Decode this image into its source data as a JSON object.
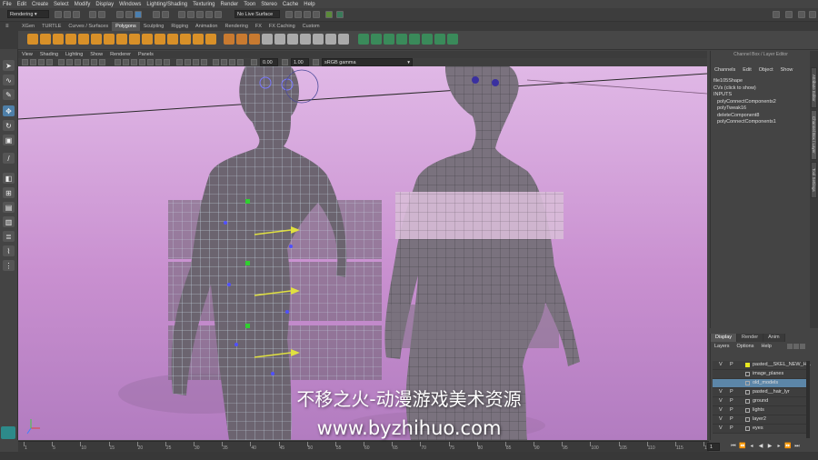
{
  "menubar": [
    "File",
    "Edit",
    "Create",
    "Select",
    "Modify",
    "Display",
    "Windows",
    "Lighting/Shading",
    "Texturing",
    "Render",
    "Toon",
    "Stereo",
    "Cache",
    "Help"
  ],
  "status": {
    "menuset": "Rendering",
    "live_surface": "No Live Surface"
  },
  "shelf_tabs": [
    "XGen",
    "TURTLE",
    "Curves / Surfaces",
    "Polygons",
    "Sculpting",
    "Rigging",
    "Animation",
    "Rendering",
    "FX",
    "FX Caching",
    "Custom"
  ],
  "shelf_active": "Polygons",
  "panel_menu": [
    "View",
    "Shading",
    "Lighting",
    "Show",
    "Renderer",
    "Panels"
  ],
  "viewport_fields": {
    "value1": "0.00",
    "value2": "1.00",
    "color_space": "sRGB gamma"
  },
  "channel_box": {
    "title": "Channel Box / Layer Editor",
    "menu": [
      "Channels",
      "Edit",
      "Object",
      "Show"
    ],
    "object": "file105Shape",
    "cvs": "CVs (click to show)",
    "inputs_header": "INPUTS",
    "inputs": [
      "polyConnectComponents2",
      "polyTweak16",
      "deleteComponent8",
      "polyConnectComponents1"
    ]
  },
  "side_tabs": [
    "Attribute Editor",
    "Channel Box / Layer Editor",
    "Tool Settings"
  ],
  "layer_editor": {
    "tabs": [
      "Display",
      "Render",
      "Anim"
    ],
    "menu": [
      "Layers",
      "Options",
      "Help"
    ],
    "rows": [
      {
        "v": "V",
        "p": "P",
        "name": "pasted__SKEL_NEW_H...",
        "color": "#e8e820",
        "selected": false
      },
      {
        "v": "",
        "p": "",
        "name": "image_planes",
        "color": "",
        "selected": false
      },
      {
        "v": "",
        "p": "",
        "name": "old_models",
        "color": "",
        "selected": true
      },
      {
        "v": "V",
        "p": "P",
        "name": "pasted__hair_lyr",
        "color": "",
        "selected": false
      },
      {
        "v": "V",
        "p": "P",
        "name": "ground",
        "color": "",
        "selected": false
      },
      {
        "v": "V",
        "p": "P",
        "name": "lights",
        "color": "",
        "selected": false
      },
      {
        "v": "V",
        "p": "P",
        "name": "layer2",
        "color": "",
        "selected": false
      },
      {
        "v": "V",
        "p": "P",
        "name": "eyes",
        "color": "",
        "selected": false
      }
    ]
  },
  "timeline": {
    "ticks": [
      "1",
      "5",
      "10",
      "15",
      "20",
      "25",
      "30",
      "35",
      "40",
      "45",
      "50",
      "55",
      "60",
      "65",
      "70",
      "75",
      "80",
      "85",
      "90",
      "95",
      "100",
      "105",
      "110",
      "115",
      "120"
    ],
    "current_frame": "1"
  },
  "watermark": {
    "line1": "不移之火-动漫游戏美术资源",
    "line2": "www.byzhihuo.com"
  }
}
